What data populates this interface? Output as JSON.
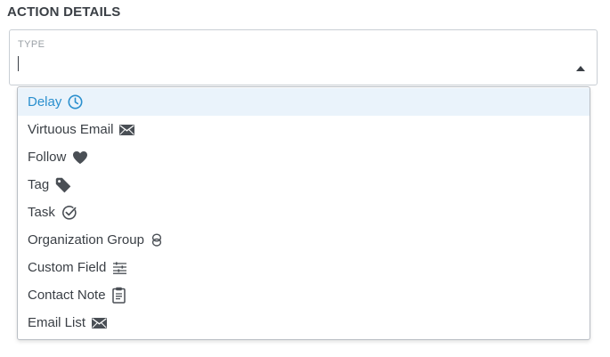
{
  "section": {
    "title": "ACTION DETAILS"
  },
  "select": {
    "label": "TYPE",
    "value": ""
  },
  "colors": {
    "accent": "#2a8fce",
    "highlight_bg": "#eaf3fb",
    "text": "#3a3f45",
    "muted": "#9aa0a6"
  },
  "options": [
    {
      "label": "Delay",
      "icon": "clock-icon",
      "highlighted": true
    },
    {
      "label": "Virtuous Email",
      "icon": "envelope-icon"
    },
    {
      "label": "Follow",
      "icon": "heart-icon"
    },
    {
      "label": "Tag",
      "icon": "tag-icon"
    },
    {
      "label": "Task",
      "icon": "check-circle-icon"
    },
    {
      "label": "Organization Group",
      "icon": "linked-rings-icon"
    },
    {
      "label": "Custom Field",
      "icon": "sliders-icon"
    },
    {
      "label": "Contact Note",
      "icon": "clipboard-icon"
    },
    {
      "label": "Email List",
      "icon": "envelope-icon"
    }
  ]
}
